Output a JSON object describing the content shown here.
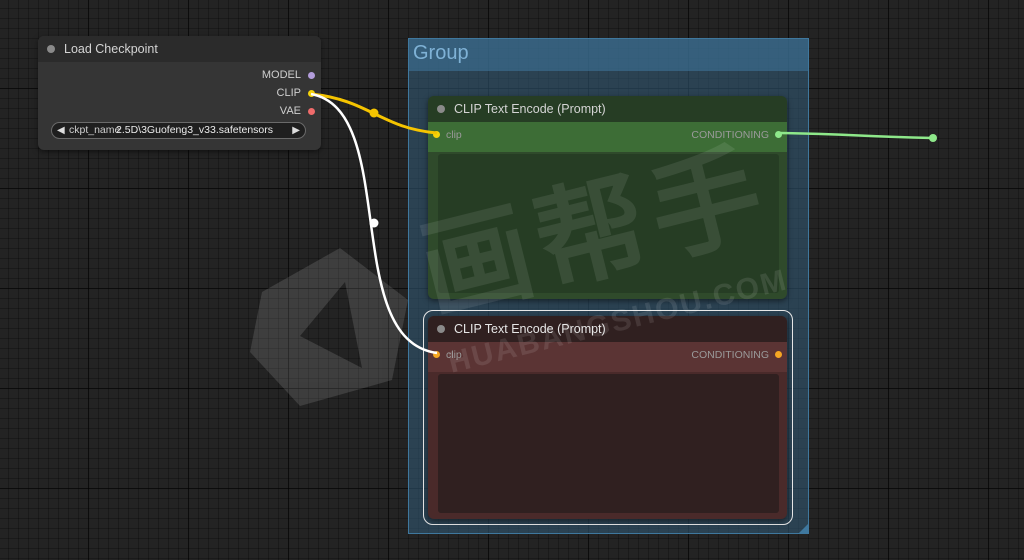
{
  "group": {
    "title": "Group"
  },
  "load_checkpoint": {
    "title": "Load Checkpoint",
    "outputs": [
      "MODEL",
      "CLIP",
      "VAE"
    ],
    "output_colors": [
      "#b39ddb",
      "#f5d40a",
      "#ef6b6b"
    ],
    "widget_label": "ckpt_name",
    "widget_value": "2.5D\\3Guofeng3_v33.safetensors",
    "prev_icon": "◀",
    "next_icon": "▶"
  },
  "clip_pos": {
    "title": "CLIP Text Encode (Prompt)",
    "input_label": "clip",
    "output_label": "CONDITIONING",
    "input_color": "#f5d40a",
    "output_color": "#8ee88a"
  },
  "clip_neg": {
    "title": "CLIP Text Encode (Prompt)",
    "input_label": "clip",
    "output_label": "CONDITIONING",
    "input_color": "#f5a623",
    "output_color": "#f5a623"
  },
  "watermark": {
    "main": "画帮手",
    "sub": "HUABANGSHOU.COM"
  },
  "colors": {
    "clip_wire": "#f5c400",
    "white_wire": "#ffffff",
    "conditioning_wire": "#8ee88a"
  }
}
